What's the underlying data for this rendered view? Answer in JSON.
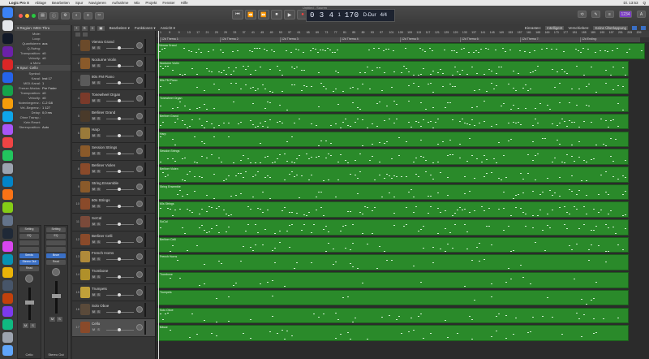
{
  "menubar": {
    "apple": "",
    "items": [
      "Logic Pro X",
      "Ablage",
      "Bearbeiten",
      "Spur",
      "Navigieren",
      "Aufnahme",
      "Mix",
      "Projekt",
      "Fenster",
      "Hilfe"
    ],
    "right": [
      "Di. 13:53",
      "Q"
    ]
  },
  "window": {
    "title": "Untitled - Spuren",
    "lcd": {
      "position": "0 3 4",
      "sub": "1",
      "tempo": "170",
      "key": "D-Dur",
      "signature": "4/4"
    },
    "transport": [
      "⏮",
      "⏪",
      "⏩",
      "⏹",
      "▶",
      "●"
    ],
    "toolbar_right": [
      "⟲",
      "✎",
      "≡",
      "1234",
      "A"
    ]
  },
  "inspector": {
    "region_head": "▾ Region: MIDI Thru",
    "region_rows": [
      {
        "label": "Mute:",
        "value": ""
      },
      {
        "label": "Loop:",
        "value": ""
      },
      {
        "label": "Quantisieren",
        "value": "aus"
      },
      {
        "label": "Q-Swing:",
        "value": ""
      },
      {
        "label": "Transposition:",
        "value": "±0"
      },
      {
        "label": "Velocity:",
        "value": "±0"
      },
      {
        "label": "▸ Mehr",
        "value": ""
      }
    ],
    "track_head": "▾ Spur: Cello",
    "track_rows": [
      {
        "label": "Symbol:",
        "value": ""
      },
      {
        "label": "Kanal:",
        "value": "Inst 17"
      },
      {
        "label": "MIDI-Kanal:",
        "value": "1"
      },
      {
        "label": "Freeze-Modus:",
        "value": "Pre Fader"
      },
      {
        "label": "Transposition:",
        "value": "±0"
      },
      {
        "label": "Velocity:",
        "value": "±0"
      },
      {
        "label": "Notenbegrenz.:",
        "value": "C-2  G8"
      },
      {
        "label": "Vel.-Begrenz.:",
        "value": "1  127"
      },
      {
        "label": "Delay:",
        "value": "0,0 ms"
      },
      {
        "label": "Ohne Transp.:",
        "value": ""
      },
      {
        "label": "Kein Reset:",
        "value": ""
      },
      {
        "label": "Stereoposition:",
        "value": "Auto"
      }
    ],
    "strip_left": {
      "slots": [
        "Setting",
        "EQ",
        "",
        "",
        "Sends",
        "Stereo Out",
        "Read"
      ],
      "name": "Cello",
      "blue_slots": [
        "Sends",
        "Stereo Out"
      ]
    },
    "strip_right": {
      "slots": [
        "Setting",
        "EQ",
        "",
        "",
        "Bnce",
        "Read"
      ],
      "name": "Stereo Out",
      "blue_slots": [
        "Bnce"
      ]
    },
    "ms": [
      "M",
      "S",
      "M",
      "S"
    ]
  },
  "trackbar": {
    "items": [
      "Bearbeiten ▾",
      "Funktionen ▾",
      "Ansicht ▾"
    ],
    "right": [
      "Einrasten:",
      "Intelligent",
      "Verschieben:",
      "Keine Überlappung"
    ],
    "tools": [
      "+",
      "S",
      "≡",
      "▣"
    ]
  },
  "tracks": [
    {
      "num": "1",
      "name": "Vienna Grand",
      "color": "#6b4a2a"
    },
    {
      "num": "2",
      "name": "Nocturne Violin",
      "color": "#8a5a2a"
    },
    {
      "num": "3",
      "name": "80s FM Piano",
      "color": "#5a5a5a"
    },
    {
      "num": "4",
      "name": "Tonewheel Organ",
      "color": "#7a3a2a"
    },
    {
      "num": "5",
      "name": "Berliner Grand",
      "color": "#4a3a2a"
    },
    {
      "num": "6",
      "name": "Harp",
      "color": "#9a7a3a"
    },
    {
      "num": "7",
      "name": "Session Strings",
      "color": "#8a5a2a"
    },
    {
      "num": "8",
      "name": "Berliner Violen",
      "color": "#8a4a2a"
    },
    {
      "num": "9",
      "name": "String Ensemble",
      "color": "#8a5a2a"
    },
    {
      "num": "10",
      "name": "60s Strings",
      "color": "#8a4a2a"
    },
    {
      "num": "11",
      "name": "SoCal",
      "color": "#7a4a3a"
    },
    {
      "num": "12",
      "name": "Berliner Celli",
      "color": "#8a4a2a"
    },
    {
      "num": "13",
      "name": "French Horns",
      "color": "#b08a3a"
    },
    {
      "num": "14",
      "name": "Trombone",
      "color": "#b0902a"
    },
    {
      "num": "15",
      "name": "Trumpets",
      "color": "#c0a03a"
    },
    {
      "num": "16",
      "name": "Solo Oboe",
      "color": "#5a4a3a"
    },
    {
      "num": "17",
      "name": "Cello",
      "color": "#8a4a2a"
    }
  ],
  "track_ms": {
    "m": "M",
    "s": "S"
  },
  "ruler": {
    "numbers": [
      "1",
      "5",
      "9",
      "13",
      "17",
      "21",
      "25",
      "29",
      "33",
      "37",
      "41",
      "45",
      "49",
      "53",
      "57",
      "61",
      "65",
      "69",
      "73",
      "77",
      "81",
      "85",
      "89",
      "93",
      "97",
      "101",
      "105",
      "109",
      "113",
      "117",
      "121",
      "125",
      "129",
      "133",
      "137",
      "141",
      "145",
      "149",
      "153",
      "157",
      "161",
      "165",
      "169",
      "173",
      "177",
      "181",
      "185",
      "189",
      "193",
      "197",
      "201",
      "205",
      "209"
    ]
  },
  "markers": [
    "12d Thema 1:",
    "12d Thema 2:",
    "12d Thema 3:",
    "12d Thema 4:",
    "12d Thema 5:",
    "12d Thema 6:",
    "12d Thema 7:",
    "12d Ending:"
  ],
  "regions": [
    "Vienna Grand",
    "Nocturne Violin",
    "80s FM Piano",
    "Tonewheel Organ",
    "Berliner Grand",
    "Harp",
    "Session Strings",
    "Berliner Violen",
    "String Ensemble",
    "60s Strings",
    "SoCal",
    "Berliner Celli",
    "French Horns",
    "Trombone",
    "Trumpets",
    "Solo Oboe",
    "Bässe"
  ],
  "colors": {
    "region": "#2a8a2a",
    "region_border": "#1d5e1d",
    "note": "#cfeecf",
    "accent": "#3a6fc4"
  }
}
